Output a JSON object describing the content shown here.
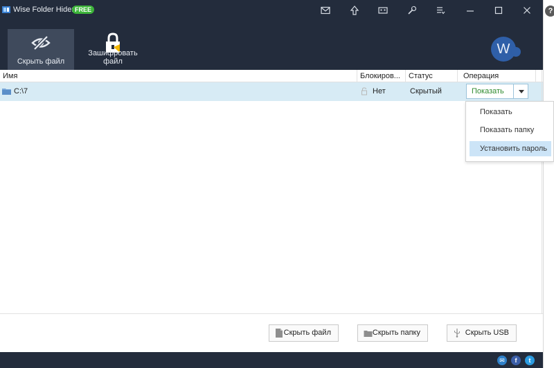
{
  "titlebar": {
    "app_title": "Wise Folder Hider",
    "badge": "FREE",
    "icons": [
      "mail-icon",
      "upgrade-icon",
      "feedback-icon",
      "tools-icon",
      "menu-icon"
    ],
    "window_controls": [
      "minimize-icon",
      "maximize-icon",
      "close-icon"
    ]
  },
  "toolbar": {
    "hide_file_label": "Скрыть файл",
    "encrypt_file_label": "Зашифровать файл",
    "avatar_letter": "W"
  },
  "table": {
    "columns": [
      "Имя",
      "Блокиров...",
      "Статус",
      "Операция"
    ],
    "rows": [
      {
        "name": "C:\\7",
        "lock": "Нет",
        "status": "Скрытый",
        "operation": "Показать"
      }
    ]
  },
  "dropdown": {
    "items": [
      "Показать",
      "Показать папку",
      "Установить пароль"
    ],
    "selected_index": 2
  },
  "bottom_buttons": {
    "hide_file": "Скрыть файл",
    "hide_folder": "Скрыть папку",
    "hide_usb": "Скрыть USB"
  },
  "help_symbol": "?",
  "social": {
    "mail": "✉",
    "facebook": "f",
    "twitter": "t"
  },
  "colors": {
    "dark_bg": "#232c3c",
    "active_tool": "#3f4a5c",
    "row_selected": "#d7ebf5",
    "free_badge": "#3db53a",
    "operation_text": "#2e8a2e",
    "dropdown_highlight": "#cce4f7"
  }
}
